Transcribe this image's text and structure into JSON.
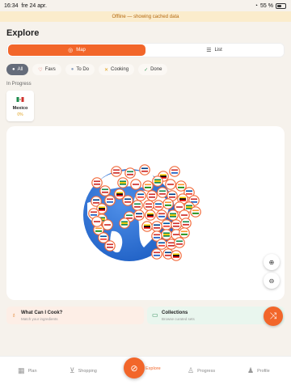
{
  "status": {
    "time": "16:34",
    "date": "fre 24 apr.",
    "battery": "55 %"
  },
  "offline_banner": "Offline — showing cached data",
  "page_title": "Explore",
  "view_toggle": {
    "map_label": "Map",
    "list_label": "List",
    "selected": "Map"
  },
  "filters": [
    {
      "label": "All",
      "icon": "dot-icon",
      "active": true
    },
    {
      "label": "Favs",
      "icon": "heart-icon",
      "active": false
    },
    {
      "label": "To Do",
      "icon": "dot-icon",
      "active": false
    },
    {
      "label": "Cooking",
      "icon": "utensils-icon",
      "active": false
    },
    {
      "label": "Done",
      "icon": "check-circle-icon",
      "active": false
    }
  ],
  "in_progress": {
    "heading": "In Progress",
    "items": [
      {
        "country": "Mexico",
        "progress": "0%"
      }
    ]
  },
  "actions": {
    "cook": {
      "title": "What Can I Cook?",
      "subtitle": "Match your ingredients",
      "icon": "bulb-icon"
    },
    "collections": {
      "title": "Collections",
      "subtitle": "Browse curated sets",
      "icon": "book-icon"
    },
    "shuffle_icon": "shuffle-icon"
  },
  "tabs": [
    {
      "label": "Plan",
      "icon": "calendar-icon"
    },
    {
      "label": "Shopping",
      "icon": "cart-icon"
    },
    {
      "label": "Explore",
      "icon": "compass-icon",
      "active": true
    },
    {
      "label": "Progress",
      "icon": "medal-icon"
    },
    {
      "label": "Profile",
      "icon": "person-icon"
    }
  ],
  "colors": {
    "accent": "#f2662a",
    "ocean": "#2b74d8",
    "land": "#ffffff",
    "pin_ring": "#f26a3a"
  }
}
